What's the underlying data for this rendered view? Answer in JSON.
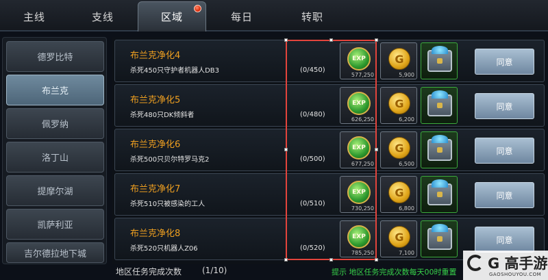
{
  "tabs": [
    {
      "label": "主线"
    },
    {
      "label": "支线"
    },
    {
      "label": "区域"
    },
    {
      "label": "每日"
    },
    {
      "label": "转职"
    }
  ],
  "active_tab": "区域",
  "sidebar": {
    "items": [
      {
        "label": "德罗比特"
      },
      {
        "label": "布兰克"
      },
      {
        "label": "佩罗纳"
      },
      {
        "label": "洛丁山"
      },
      {
        "label": "提摩尔湖"
      },
      {
        "label": "凯萨利亚"
      },
      {
        "label": "吉尔德拉地下城"
      }
    ],
    "active": "布兰克"
  },
  "quests": [
    {
      "name": "布兰克净化4",
      "desc": "杀死450只守护者机器人DB3",
      "progress": "(0/450)",
      "exp": "577,250",
      "gold": "5,900",
      "button": "同意"
    },
    {
      "name": "布兰克净化5",
      "desc": "杀死480只DK倾斜者",
      "progress": "(0/480)",
      "exp": "626,250",
      "gold": "6,200",
      "button": "同意"
    },
    {
      "name": "布兰克净化6",
      "desc": "杀死500只贝尔特罗马克2",
      "progress": "(0/500)",
      "exp": "677,250",
      "gold": "6,500",
      "button": "同意"
    },
    {
      "name": "布兰克净化7",
      "desc": "杀死510只被感染的工人",
      "progress": "(0/510)",
      "exp": "730,250",
      "gold": "6,800",
      "button": "同意"
    },
    {
      "name": "布兰克净化8",
      "desc": "杀死520只机器人Z06",
      "progress": "(0/520)",
      "exp": "785,250",
      "gold": "7,100",
      "button": "同意"
    }
  ],
  "reward_icons": {
    "exp_text": "EXP",
    "coin_text": "G"
  },
  "footer": {
    "label": "地区任务完成次数",
    "count": "(1/10)",
    "tip": "提示 地区任务完成次数每天00时重置"
  },
  "watermark": {
    "text": "G 高手游",
    "url": "GAOSHOUYOU.COM"
  },
  "colors": {
    "quest_name": "#f0a020",
    "tip": "#37d14a",
    "selection_box": "#e3443c",
    "badge": "#d42000"
  }
}
